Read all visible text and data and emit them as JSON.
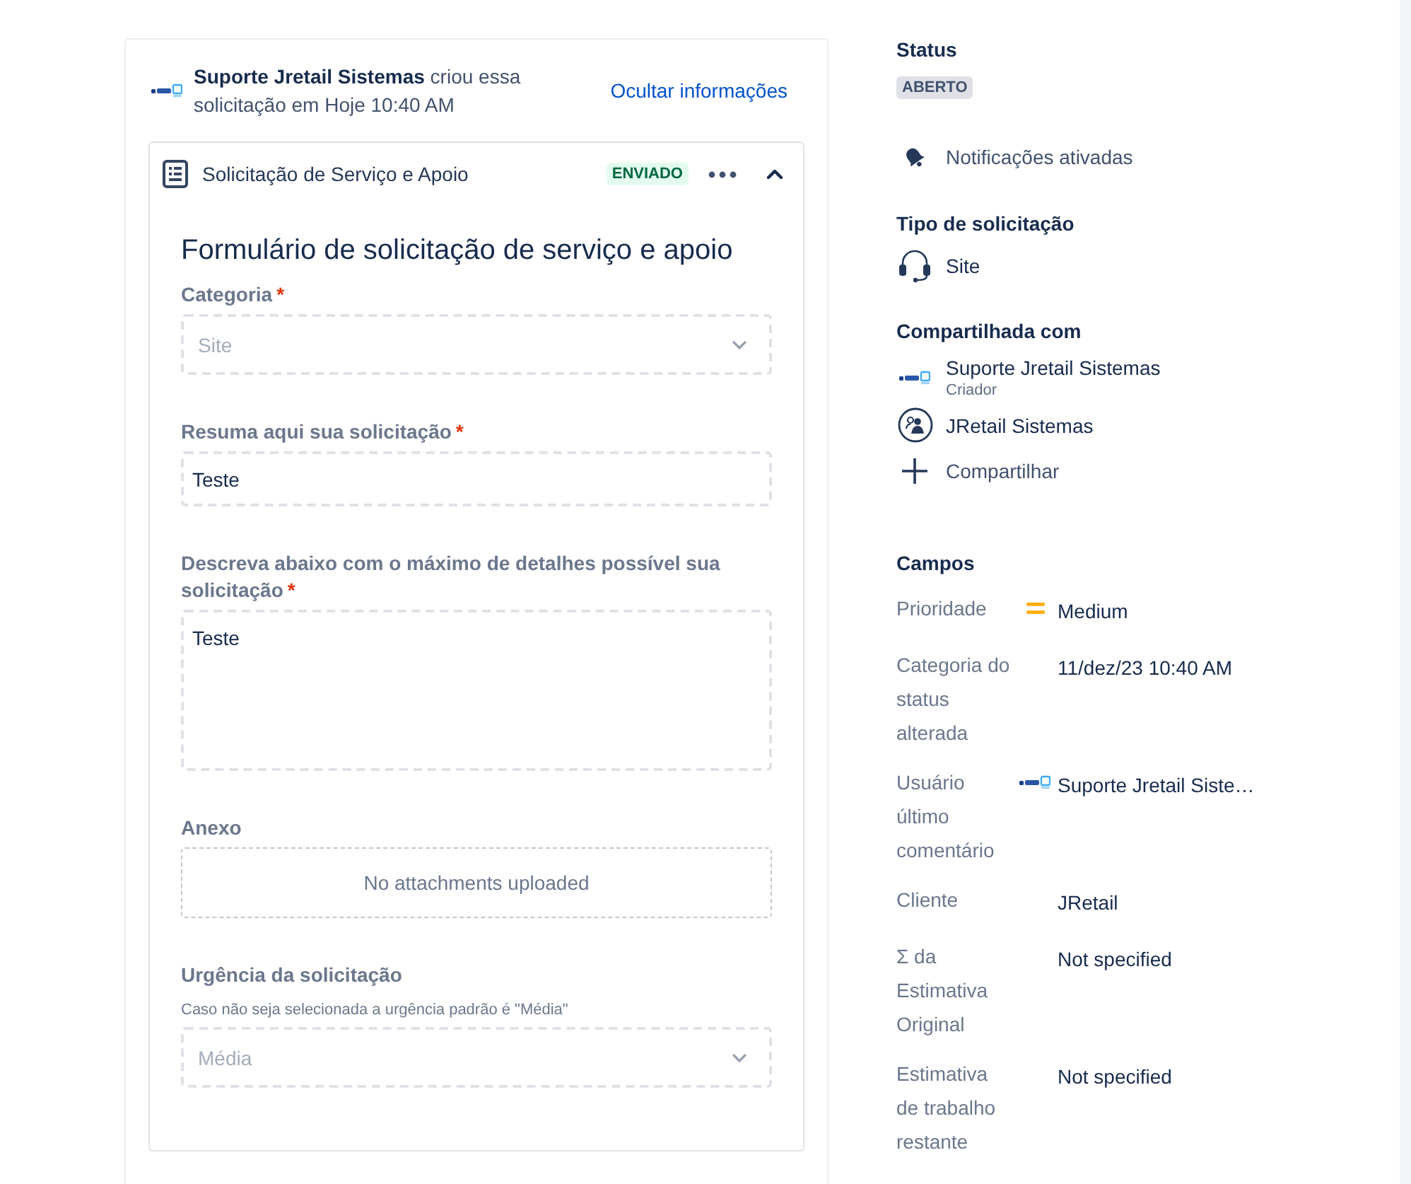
{
  "request_header": {
    "summary": "**Suporte Jretail Sistemas** criou essa solicitação em Hoje 10:40 AM",
    "toggle_link": "Ocultar informações"
  },
  "form_card": {
    "title": "Solicitação de Serviço e Apoio",
    "status_badge": "ENVIADO",
    "expanded": true,
    "form": {
      "heading": "Formulário de solicitação de serviço e apoio",
      "fields": [
        {
          "kind": "select",
          "label": "Categoria",
          "required_mark": "*",
          "value": "Site"
        },
        {
          "kind": "text",
          "label": "Resuma aqui sua solicitação",
          "required_mark": "*",
          "value": "Teste"
        },
        {
          "kind": "textarea",
          "label": "Descreva abaixo com o máximo de detalhes possível sua solicitação",
          "required_mark": "*",
          "value": "Teste"
        },
        {
          "kind": "attachments",
          "label": "Anexo",
          "value": "No attachments uploaded"
        },
        {
          "kind": "select",
          "label": "Urgência da solicitação",
          "help": "Caso não seja selecionada a urgência padrão é \"Média\"",
          "value": "Média"
        }
      ]
    }
  },
  "sidebar": {
    "status": {
      "heading": "Status",
      "badge": "ABERTO"
    },
    "notifications": {
      "label": "Notificações ativadas",
      "on": true
    },
    "request_type": {
      "heading": "Tipo de solicitação",
      "value": "Site"
    },
    "shared_with": {
      "heading": "Compartilhada com",
      "people": [
        {
          "kind": "user",
          "name": "Suporte Jretail Sistemas",
          "role": "Criador"
        },
        {
          "kind": "organization",
          "name": "JRetail Sistemas"
        }
      ],
      "share_action": "Compartilhar"
    },
    "fields": {
      "heading": "Campos",
      "rows": [
        {
          "kind": "priority",
          "label": "Prioridade",
          "value": "Medium"
        },
        {
          "kind": "text",
          "label": "Categoria do status alterada",
          "value": "11/dez/23 10:40 AM"
        },
        {
          "kind": "user",
          "label": "Usuário último comentário",
          "value": "Suporte Jretail Siste…"
        },
        {
          "kind": "text",
          "label": "Cliente",
          "value": "JRetail"
        },
        {
          "kind": "text",
          "label": "Σ da Estimativa Original",
          "value": "Not specified"
        },
        {
          "kind": "text",
          "label": "Estimativa de trabalho restante",
          "value": "Not specified"
        }
      ]
    }
  }
}
